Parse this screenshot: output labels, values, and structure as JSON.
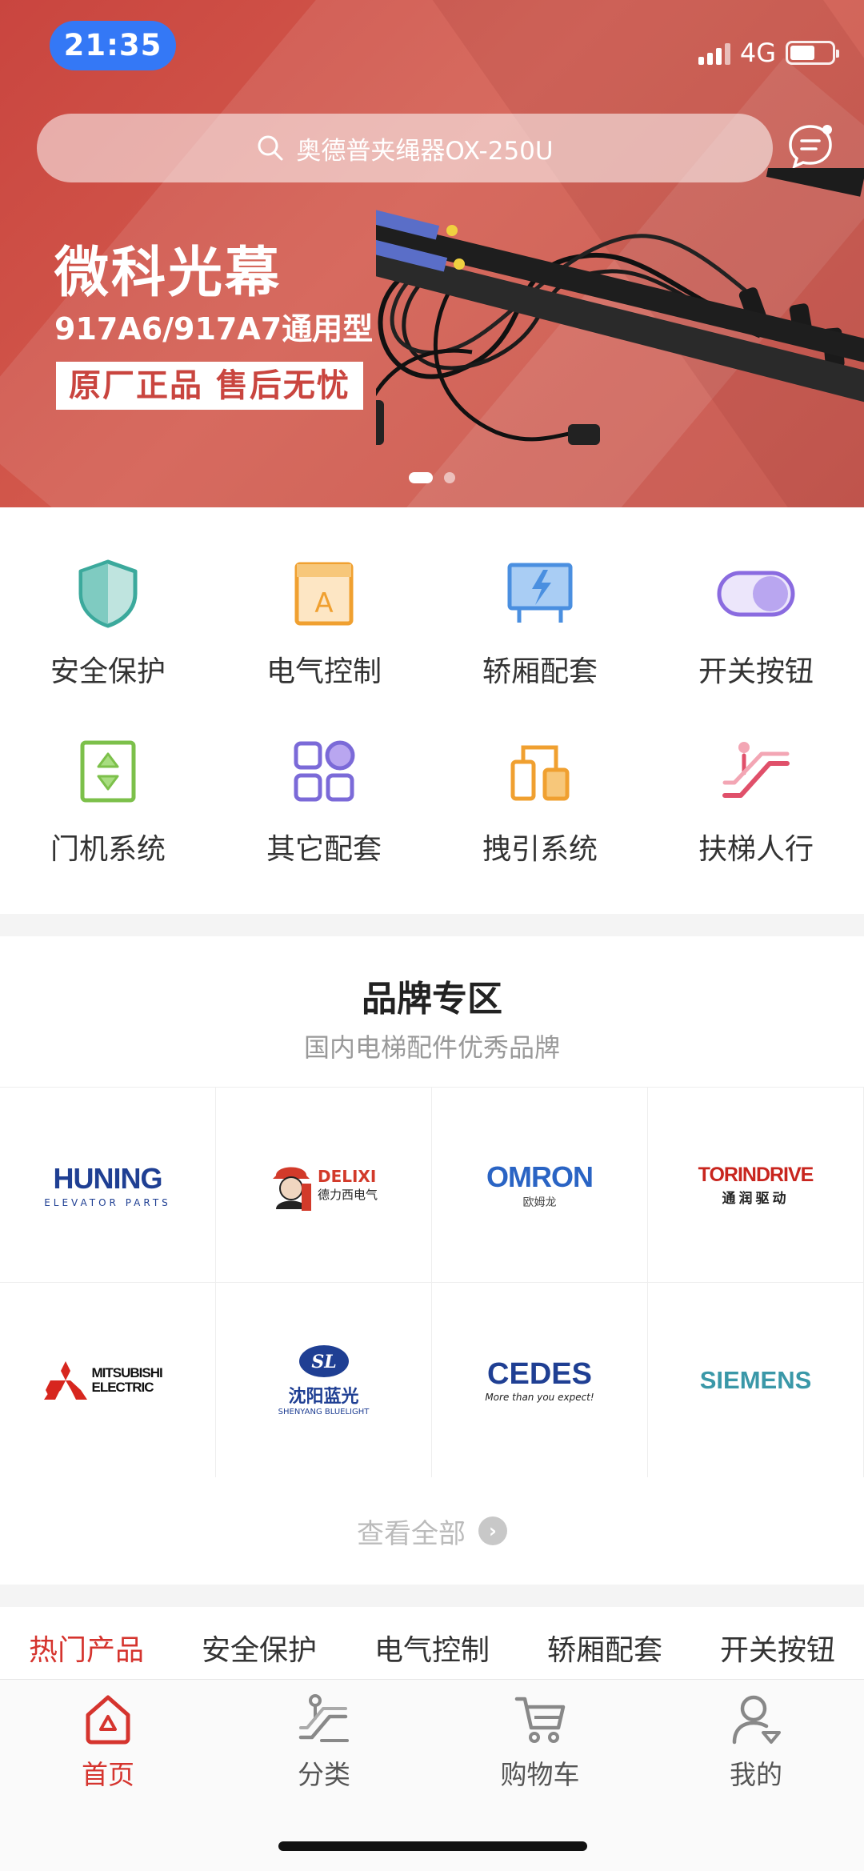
{
  "status": {
    "time": "21:35",
    "network": "4G"
  },
  "search": {
    "placeholder": "奥德普夹绳器OX-250U"
  },
  "banner": {
    "title": "微科光幕",
    "subtitle": "917A6/917A7通用型",
    "tag": "原厂正品 售后无忧",
    "slide_count": 2,
    "active_slide": 0
  },
  "categories": [
    {
      "label": "安全保护",
      "icon": "shield-icon",
      "color": "#3ba99c"
    },
    {
      "label": "电气控制",
      "icon": "panel-a-icon",
      "color": "#f0a030"
    },
    {
      "label": "轿厢配套",
      "icon": "car-cabin-icon",
      "color": "#4a8fe0"
    },
    {
      "label": "开关按钮",
      "icon": "toggle-icon",
      "color": "#8a6be0"
    },
    {
      "label": "门机系统",
      "icon": "door-updown-icon",
      "color": "#7cc04a"
    },
    {
      "label": "其它配套",
      "icon": "grid-apps-icon",
      "color": "#7b6ad8"
    },
    {
      "label": "拽引系统",
      "icon": "traction-icon",
      "color": "#f0a030"
    },
    {
      "label": "扶梯人行",
      "icon": "escalator-icon",
      "color": "#e0506a"
    }
  ],
  "brands": {
    "title": "品牌专区",
    "subtitle": "国内电梯配件优秀品牌",
    "items": [
      {
        "name": "HUNING",
        "sub": "ELEVATOR PARTS"
      },
      {
        "name": "DELIXI",
        "sub": "德力西电气"
      },
      {
        "name": "OMRON",
        "sub": "欧姆龙"
      },
      {
        "name": "TORINDRIVE",
        "sub": "通润驱动"
      },
      {
        "name": "MITSUBISHI ELECTRIC",
        "sub": ""
      },
      {
        "name": "沈阳蓝光",
        "sub": "SHENYANG BLUELIGHT"
      },
      {
        "name": "CEDES",
        "sub": "More than you expect!"
      },
      {
        "name": "SIEMENS",
        "sub": ""
      }
    ],
    "view_all": "查看全部"
  },
  "product_tabs": [
    "热门产品",
    "安全保护",
    "电气控制",
    "轿厢配套",
    "开关按钮"
  ],
  "tabbar": [
    {
      "label": "首页",
      "icon": "home-icon"
    },
    {
      "label": "分类",
      "icon": "category-icon"
    },
    {
      "label": "购物车",
      "icon": "cart-icon"
    },
    {
      "label": "我的",
      "icon": "profile-icon"
    }
  ],
  "colors": {
    "accent": "#d5342e",
    "banner": "#c9453f"
  }
}
